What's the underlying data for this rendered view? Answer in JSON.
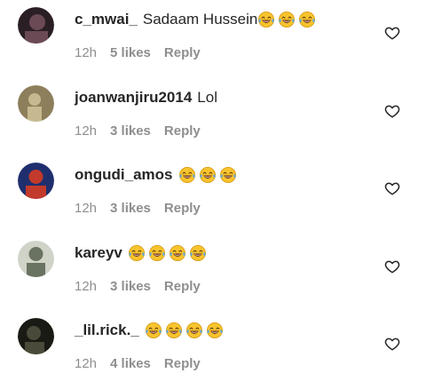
{
  "comments": [
    {
      "username": "c_mwai_",
      "text": "Sadaam Hussein",
      "laugh_emojis": 3,
      "time": "12h",
      "likes": "5 likes",
      "reply": "Reply",
      "avatar_colors": [
        "#2a1f24",
        "#6b4a55"
      ]
    },
    {
      "username": "joanwanjiru2014",
      "text": "Lol",
      "laugh_emojis": 0,
      "time": "12h",
      "likes": "3 likes",
      "reply": "Reply",
      "avatar_colors": [
        "#8d7f5c",
        "#c7b98f"
      ]
    },
    {
      "username": "ongudi_amos",
      "text": "",
      "laugh_emojis": 3,
      "time": "12h",
      "likes": "3 likes",
      "reply": "Reply",
      "avatar_colors": [
        "#1f2f6e",
        "#c23a2b"
      ]
    },
    {
      "username": "kareyv",
      "text": "",
      "laugh_emojis": 4,
      "time": "12h",
      "likes": "3 likes",
      "reply": "Reply",
      "avatar_colors": [
        "#cfd3c8",
        "#6a7262"
      ]
    },
    {
      "username": "_lil.rick._",
      "text": "",
      "laugh_emojis": 4,
      "time": "12h",
      "likes": "4 likes",
      "reply": "Reply",
      "avatar_colors": [
        "#1a1a14",
        "#4a4a3a"
      ]
    }
  ],
  "icons": {
    "like": "heart-outline-icon",
    "emoji": "face-with-tears-of-joy-icon"
  },
  "colors": {
    "text": "#262626",
    "meta": "#8e8e8e",
    "emoji_face": "#f7c32e",
    "emoji_tear": "#5aa9e6"
  }
}
